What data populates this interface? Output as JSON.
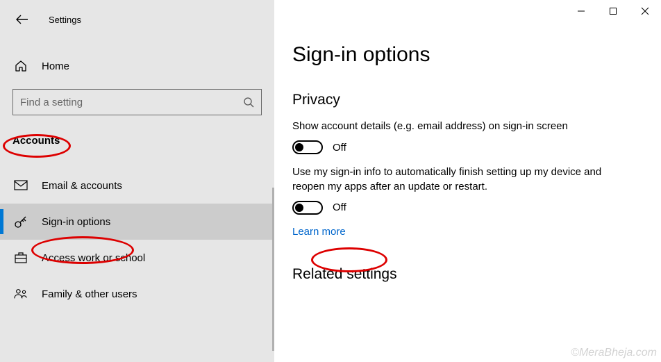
{
  "titlebar": {
    "title": "Settings"
  },
  "home": {
    "label": "Home"
  },
  "search": {
    "placeholder": "Find a setting"
  },
  "section": "Accounts",
  "nav": {
    "items": [
      {
        "label": "Email & accounts"
      },
      {
        "label": "Sign-in options"
      },
      {
        "label": "Access work or school"
      },
      {
        "label": "Family & other users"
      }
    ]
  },
  "main": {
    "title": "Sign-in options",
    "privacy": {
      "heading": "Privacy",
      "setting1": {
        "desc": "Show account details (e.g. email address) on sign-in screen",
        "state": "Off"
      },
      "setting2": {
        "desc": "Use my sign-in info to automatically finish setting up my device and reopen my apps after an update or restart.",
        "state": "Off"
      },
      "learn_more": "Learn more"
    },
    "related": {
      "heading": "Related settings"
    }
  },
  "watermark": "©MeraBheja.com"
}
